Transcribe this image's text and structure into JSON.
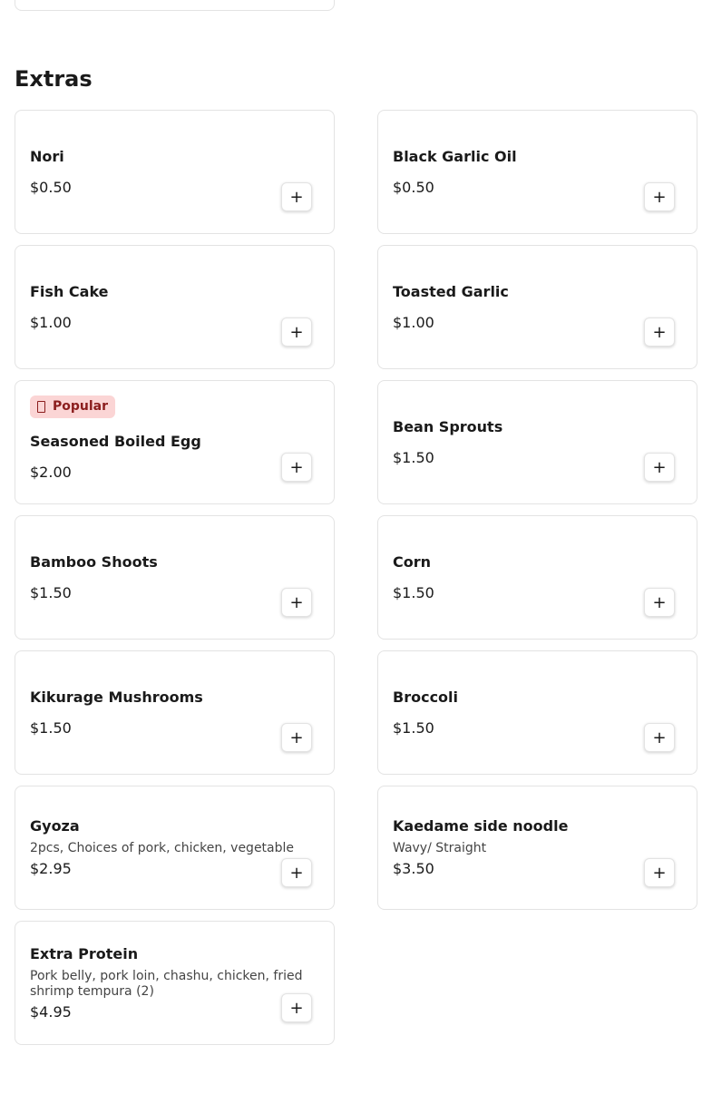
{
  "section": {
    "title": "Extras"
  },
  "add_label": "+",
  "badge_icon": "tag-icon",
  "colors": {
    "badge_bg": "#fbd5d5",
    "badge_text": "#8b1d1d",
    "border": "#e3e3e3"
  },
  "items": [
    {
      "name": "Nori",
      "price": "$0.50"
    },
    {
      "name": "Black Garlic Oil",
      "price": "$0.50"
    },
    {
      "name": "Fish Cake",
      "price": "$1.00"
    },
    {
      "name": "Toasted Garlic",
      "price": "$1.00"
    },
    {
      "name": "Seasoned Boiled Egg",
      "price": "$2.00",
      "badge": "Popular"
    },
    {
      "name": "Bean Sprouts",
      "price": "$1.50"
    },
    {
      "name": "Bamboo Shoots",
      "price": "$1.50"
    },
    {
      "name": "Corn",
      "price": "$1.50"
    },
    {
      "name": "Kikurage Mushrooms",
      "price": "$1.50"
    },
    {
      "name": "Broccoli",
      "price": "$1.50"
    },
    {
      "name": "Gyoza",
      "price": "$2.95",
      "description": "2pcs, Choices of pork, chicken, vegetable"
    },
    {
      "name": "Kaedame side noodle",
      "price": "$3.50",
      "description": "Wavy/ Straight"
    },
    {
      "name": "Extra Protein",
      "price": "$4.95",
      "description": "Pork belly, pork loin, chashu, chicken, fried shrimp tempura (2)"
    }
  ]
}
